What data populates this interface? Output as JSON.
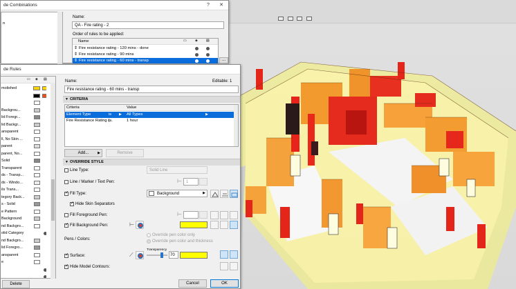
{
  "combinations_dialog": {
    "title": "de Combinations",
    "left_stub": "n",
    "name_label": "Name:",
    "name_value": "QA - Fire rating - 2",
    "order_label": "Order of rules to be applied:",
    "col_name": "Name",
    "rules": [
      {
        "label": "Fire resistance rating - 120 mins - done",
        "selected": false
      },
      {
        "label": "Fire resistance rating - 90 mins",
        "selected": false
      },
      {
        "label": "Fire resistance rating - 60 mins - transp",
        "selected": true
      }
    ]
  },
  "rules_dialog": {
    "title": "de Rules",
    "left_items": [
      "molished",
      "",
      "",
      "Backgrou...",
      "lid Foregr...",
      "lid Backgr...",
      "ansparent",
      "ll, No Skin ...",
      "parent",
      "parent, No...",
      "Solid",
      "Transparent",
      "ds - Transp...",
      "ds - Windo...",
      "ils Trans...",
      "tegory Back...",
      "s - Solid",
      "e Pattern",
      "Background",
      "nd Backgro...",
      "olid Category",
      "nd Backgro...",
      "lid Foregro...",
      "ansparent",
      "e",
      "",
      ""
    ],
    "delete_label": "Delete",
    "name_label": "Name:",
    "editable_label": "Editable: 1",
    "name_value": "Fire resistance rating - 60 mins - transp",
    "criteria_header": "CRITERIA",
    "criteria_cols": {
      "criteria": "Criteria",
      "value": "Value"
    },
    "criteria_rows": [
      {
        "criteria": "Element Type",
        "op": "is",
        "value": "All Types",
        "selected": true
      },
      {
        "criteria": "Fire Resistance Rating (...",
        "op": "is",
        "value": "1 hour",
        "selected": false
      }
    ],
    "add_label": "Add...",
    "remove_label": "Remove",
    "override_header": "OVERRIDE STYLE",
    "line_type_label": "Line Type:",
    "line_type_value": "Solid Line",
    "line_marker_label": "Line / Marker / Text Pen:",
    "pen_number": "1",
    "fill_type_label": "Fill Type:",
    "fill_type_value": "Background",
    "hide_skin_label": "Hide Skin Separators",
    "fill_fg_label": "Fill Foreground Pen:",
    "fill_bg_label": "Fill Background Pen:",
    "pens_colors_label": "Pens / Colors:",
    "override_pen_only": "Override pen color only",
    "override_pen_thick": "Override pen color and thickness",
    "transparency_label": "Transparency",
    "surface_label": "Surface:",
    "surface_transparency": "70",
    "hide_contours_label": "Hide Model Contours:",
    "cancel_label": "Cancel",
    "ok_label": "OK",
    "colors": {
      "fill_bg": "#ffff00",
      "surface": "#ffff00"
    }
  }
}
